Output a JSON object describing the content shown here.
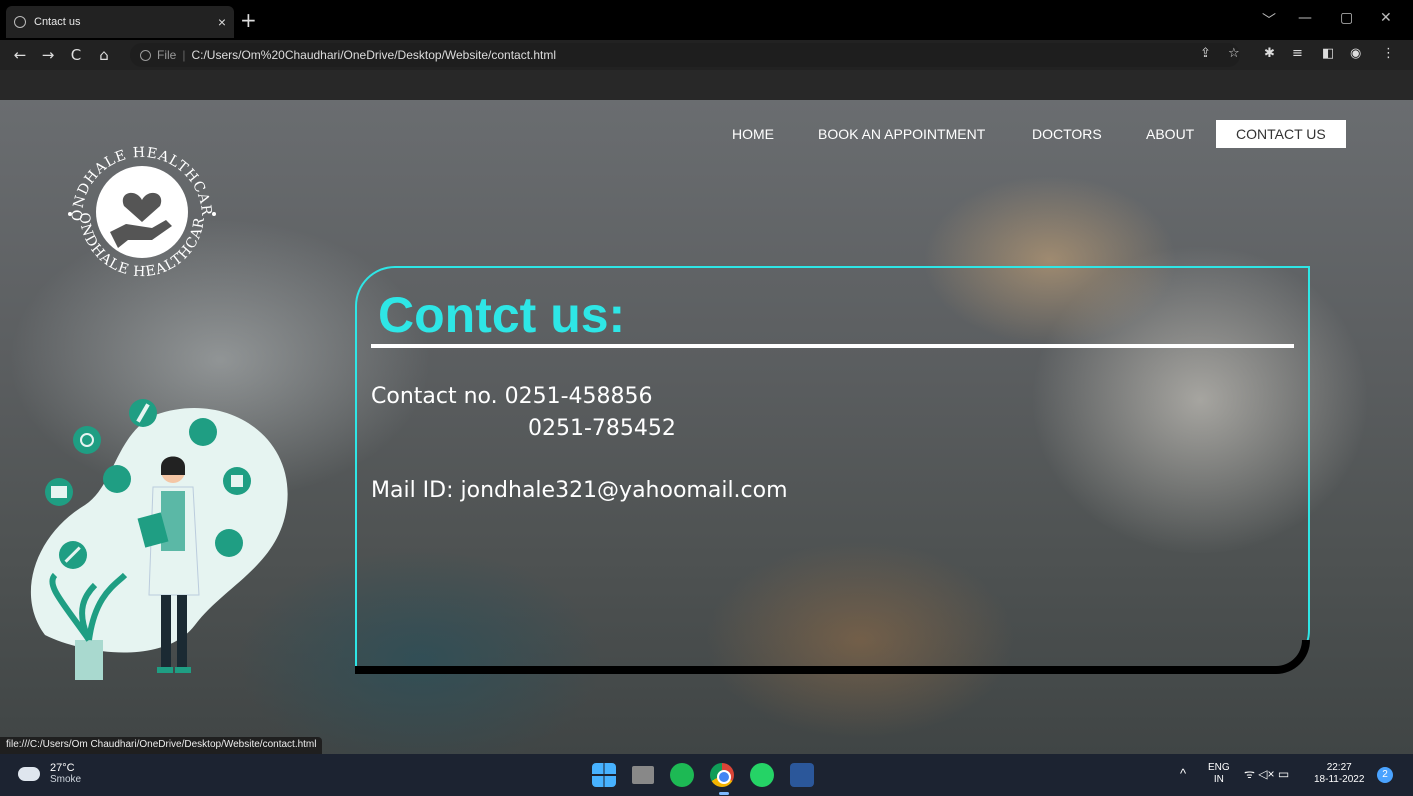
{
  "browser": {
    "tab_title": "Cntact us",
    "tab_close": "×",
    "new_tab": "+",
    "window_controls": [
      "﹀",
      "—",
      "▢",
      "✕"
    ],
    "nav_buttons": [
      "←",
      "→",
      "C",
      "⌂"
    ],
    "address_label": "File",
    "address_sep": "|",
    "url": "C:/Users/Om%20Chaudhari/OneDrive/Desktop/Website/contact.html",
    "toolbar_icons": [
      "share-icon",
      "star-icon",
      "extensions-icon",
      "reading-list-icon",
      "sidepanel-icon",
      "profile-icon",
      "menu-icon"
    ],
    "status_url": "file:///C:/Users/Om Chaudhari/OneDrive/Desktop/Website/contact.html"
  },
  "site": {
    "logo_text_top": "JONDHALE HEALTHCARE",
    "logo_text_bottom": "JONDHALE HEALTHCARE",
    "nav": [
      {
        "label": "HOME",
        "active": false
      },
      {
        "label": "BOOK AN APPOINTMENT",
        "active": false
      },
      {
        "label": "DOCTORS",
        "active": false
      },
      {
        "label": "ABOUT",
        "active": false
      },
      {
        "label": "CONTACT US",
        "active": true
      }
    ],
    "contact": {
      "title": "Contct us:",
      "phone_label": "Contact no. 0251-458856",
      "phone_alt": "0251-785452",
      "mail": "Mail ID: jondhale321@yahoomail.com"
    },
    "colors": {
      "accent": "#2ee6e6",
      "illustration_teal": "#1f9e83"
    }
  },
  "taskbar": {
    "weather_temp": "27°C",
    "weather_cond": "Smoke",
    "apps": [
      "windows-start-icon",
      "task-view-icon",
      "spotify-icon",
      "chrome-icon",
      "whatsapp-icon",
      "word-icon"
    ],
    "lang_top": "ENG",
    "lang_bottom": "IN",
    "caret": "^",
    "tray_icons": "ᯤ ◁× ▭",
    "time": "22:27",
    "date": "18-11-2022",
    "notifications": "2"
  }
}
